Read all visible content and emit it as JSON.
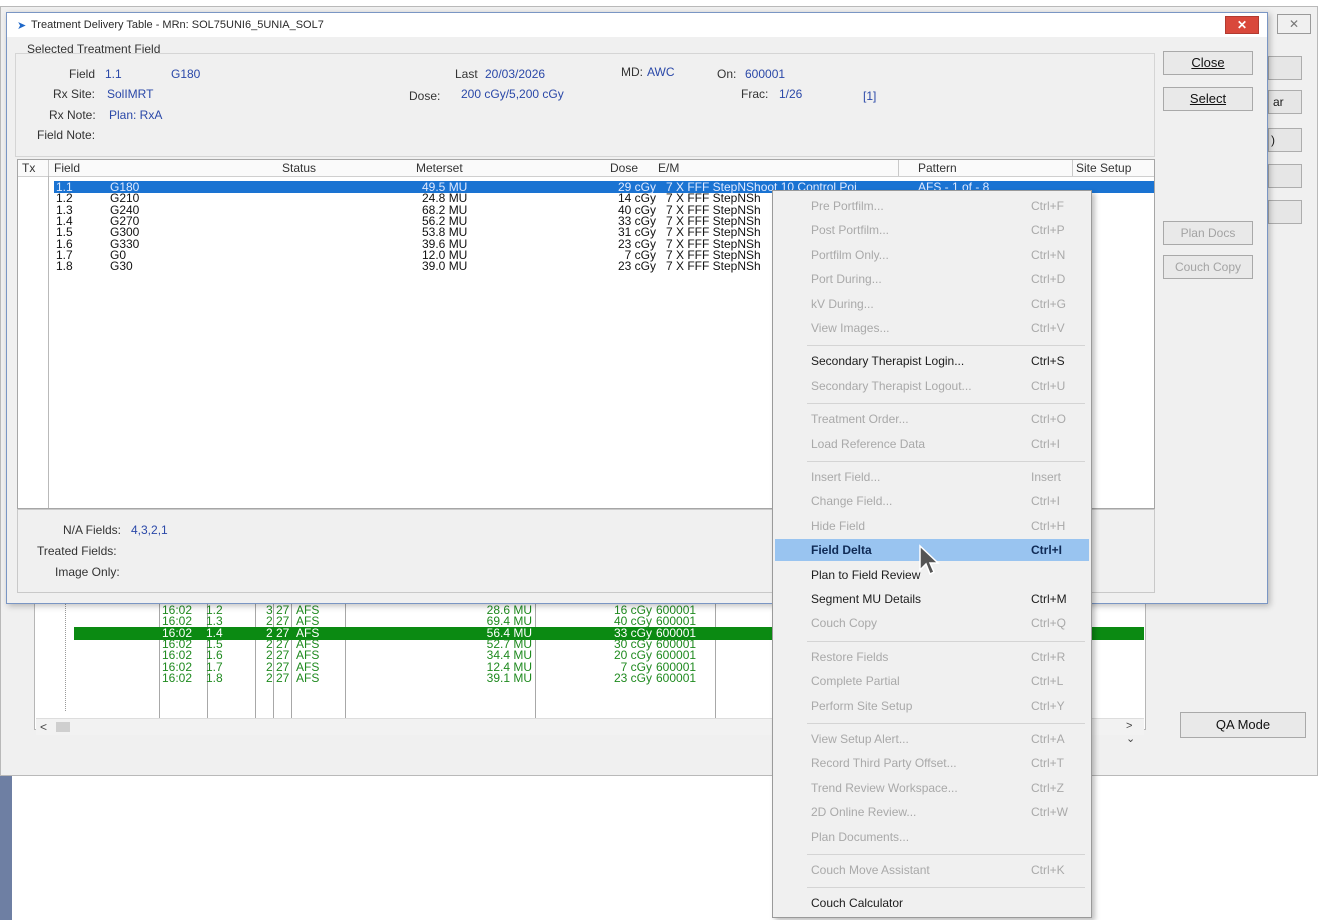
{
  "window": {
    "title": "Treatment Delivery Table - MRn: SOL75UNI6_5UNIA_SOL7",
    "close_glyph": "✕",
    "bg_close_glyph": "✕"
  },
  "background": {
    "partial_label": "ar",
    "partial_label2": ")",
    "history_rows": [
      {
        "time": "16:02",
        "field": "1.2",
        "a": "3",
        "b": "27",
        "c": "AFS",
        "mu": "28.6 MU",
        "dose": "16 cGy",
        "id": "600001",
        "selected": false
      },
      {
        "time": "16:02",
        "field": "1.3",
        "a": "2",
        "b": "27",
        "c": "AFS",
        "mu": "69.4 MU",
        "dose": "40 cGy",
        "id": "600001",
        "selected": false
      },
      {
        "time": "16:02",
        "field": "1.4",
        "a": "2",
        "b": "27",
        "c": "AFS",
        "mu": "56.4 MU",
        "dose": "33 cGy",
        "id": "600001",
        "selected": true
      },
      {
        "time": "16:02",
        "field": "1.5",
        "a": "2",
        "b": "27",
        "c": "AFS",
        "mu": "52.7 MU",
        "dose": "30 cGy",
        "id": "600001",
        "selected": false
      },
      {
        "time": "16:02",
        "field": "1.6",
        "a": "2",
        "b": "27",
        "c": "AFS",
        "mu": "34.4 MU",
        "dose": "20 cGy",
        "id": "600001",
        "selected": false
      },
      {
        "time": "16:02",
        "field": "1.7",
        "a": "2",
        "b": "27",
        "c": "AFS",
        "mu": "12.4 MU",
        "dose": "7 cGy",
        "id": "600001",
        "selected": false
      },
      {
        "time": "16:02",
        "field": "1.8",
        "a": "2",
        "b": "27",
        "c": "AFS",
        "mu": "39.1 MU",
        "dose": "23 cGy",
        "id": "600001",
        "selected": false
      }
    ],
    "scroll_left": "<",
    "scroll_right": "> ⌄",
    "qa_mode_label": "QA Mode"
  },
  "selected_field": {
    "heading": "Selected Treatment Field",
    "field_label": "Field",
    "field_value": "1.1",
    "gantry_value": "G180",
    "last_label": "Last",
    "last_value": "20/03/2026",
    "md_label": "MD:",
    "md_value": "AWC",
    "on_label": "On:",
    "on_value": "600001",
    "rx_site_label": "Rx Site:",
    "rx_site_value": "SolIMRT",
    "dose_label": "Dose:",
    "dose_value": "200 cGy/5,200 cGy",
    "frac_label": "Frac:",
    "frac_value": "1/26",
    "frac_bracket": "[1]",
    "rx_note_label": "Rx Note:",
    "rx_note_value": "Plan: RxA",
    "field_note_label": "Field Note:"
  },
  "buttons": {
    "close": "Close",
    "select": "Select",
    "plan_docs": "Plan Docs",
    "couch_copy": "Couch Copy"
  },
  "field_list": {
    "headers": {
      "tx": "Tx",
      "field": "Field",
      "status": "Status",
      "meterset": "Meterset",
      "dose": "Dose",
      "em": "E/M",
      "pattern": "Pattern",
      "site_setup": "Site Setup"
    },
    "rows": [
      {
        "id": "1.1",
        "gantry": "G180",
        "mu": "49.5 MU",
        "dose": "29 cGy",
        "em": "7 X FFF StepNShoot 10 Control Poi",
        "pattern": "AFS - 1 of - 8",
        "selected": true
      },
      {
        "id": "1.2",
        "gantry": "G210",
        "mu": "24.8 MU",
        "dose": "14 cGy",
        "em": "7 X FFF StepNSh",
        "pattern": "",
        "selected": false
      },
      {
        "id": "1.3",
        "gantry": "G240",
        "mu": "68.2 MU",
        "dose": "40 cGy",
        "em": "7 X FFF StepNSh",
        "pattern": "",
        "selected": false
      },
      {
        "id": "1.4",
        "gantry": "G270",
        "mu": "56.2 MU",
        "dose": "33 cGy",
        "em": "7 X FFF StepNSh",
        "pattern": "",
        "selected": false
      },
      {
        "id": "1.5",
        "gantry": "G300",
        "mu": "53.8 MU",
        "dose": "31 cGy",
        "em": "7 X FFF StepNSh",
        "pattern": "",
        "selected": false
      },
      {
        "id": "1.6",
        "gantry": "G330",
        "mu": "39.6 MU",
        "dose": "23 cGy",
        "em": "7 X FFF StepNSh",
        "pattern": "",
        "selected": false
      },
      {
        "id": "1.7",
        "gantry": "G0",
        "mu": "12.0 MU",
        "dose": "7 cGy",
        "em": "7 X FFF StepNSh",
        "pattern": "",
        "selected": false
      },
      {
        "id": "1.8",
        "gantry": "G30",
        "mu": "39.0 MU",
        "dose": "23 cGy",
        "em": "7 X FFF StepNSh",
        "pattern": "",
        "selected": false
      }
    ]
  },
  "bottom": {
    "na_fields_label": "N/A Fields:",
    "na_fields_value": "4,3,2,1",
    "treated_fields_label": "Treated Fields:",
    "image_only_label": "Image Only:"
  },
  "context_menu": {
    "items": [
      {
        "label": "Pre Portfilm...",
        "shortcut": "Ctrl+F",
        "state": "disabled"
      },
      {
        "label": "Post Portfilm...",
        "shortcut": "Ctrl+P",
        "state": "disabled"
      },
      {
        "label": "Portfilm Only...",
        "shortcut": "Ctrl+N",
        "state": "disabled"
      },
      {
        "label": "Port During...",
        "shortcut": "Ctrl+D",
        "state": "disabled"
      },
      {
        "label": "kV During...",
        "shortcut": "Ctrl+G",
        "state": "disabled"
      },
      {
        "label": "View Images...",
        "shortcut": "Ctrl+V",
        "state": "disabled"
      },
      {
        "sep": true
      },
      {
        "label": "Secondary Therapist Login...",
        "shortcut": "Ctrl+S",
        "state": "enabled"
      },
      {
        "label": "Secondary Therapist Logout...",
        "shortcut": "Ctrl+U",
        "state": "disabled"
      },
      {
        "sep": true
      },
      {
        "label": "Treatment Order...",
        "shortcut": "Ctrl+O",
        "state": "disabled"
      },
      {
        "label": "Load Reference Data",
        "shortcut": "Ctrl+I",
        "state": "disabled"
      },
      {
        "sep": true
      },
      {
        "label": "Insert Field...",
        "shortcut": "Insert",
        "state": "disabled"
      },
      {
        "label": "Change Field...",
        "shortcut": "Ctrl+I",
        "state": "disabled"
      },
      {
        "label": "Hide Field",
        "shortcut": "Ctrl+H",
        "state": "disabled"
      },
      {
        "label": "Field Delta",
        "shortcut": "Ctrl+I",
        "state": "highlighted"
      },
      {
        "label": "Plan to Field Review",
        "shortcut": "",
        "state": "enabled"
      },
      {
        "label": "Segment MU Details",
        "shortcut": "Ctrl+M",
        "state": "enabled"
      },
      {
        "label": "Couch Copy",
        "shortcut": "Ctrl+Q",
        "state": "disabled"
      },
      {
        "sep": true
      },
      {
        "label": "Restore Fields",
        "shortcut": "Ctrl+R",
        "state": "disabled"
      },
      {
        "label": "Complete Partial",
        "shortcut": "Ctrl+L",
        "state": "disabled"
      },
      {
        "label": "Perform Site Setup",
        "shortcut": "Ctrl+Y",
        "state": "disabled"
      },
      {
        "sep": true
      },
      {
        "label": "View Setup Alert...",
        "shortcut": "Ctrl+A",
        "state": "disabled"
      },
      {
        "label": "Record Third Party Offset...",
        "shortcut": "Ctrl+T",
        "state": "disabled"
      },
      {
        "label": "Trend Review Workspace...",
        "shortcut": "Ctrl+Z",
        "state": "disabled"
      },
      {
        "label": "2D Online Review...",
        "shortcut": "Ctrl+W",
        "state": "disabled"
      },
      {
        "label": "Plan Documents...",
        "shortcut": "",
        "state": "disabled"
      },
      {
        "sep": true
      },
      {
        "label": "Couch Move Assistant",
        "shortcut": "Ctrl+K",
        "state": "disabled"
      },
      {
        "sep": true
      },
      {
        "label": "Couch Calculator",
        "shortcut": "",
        "state": "enabled"
      }
    ]
  }
}
